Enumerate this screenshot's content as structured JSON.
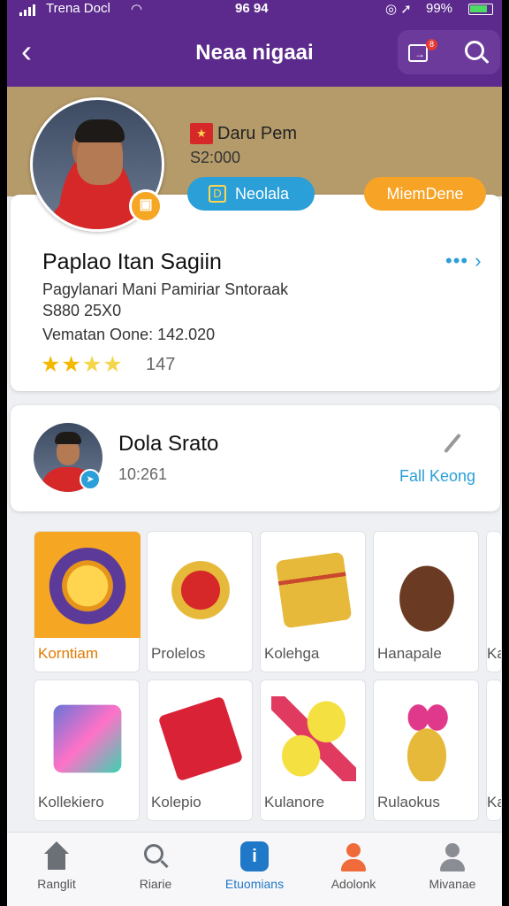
{
  "status_bar": {
    "carrier": "Trena Docl",
    "time": "96 94",
    "battery_percent": "99%"
  },
  "header": {
    "title": "Neaa nigaai",
    "notification_count": "8"
  },
  "profile": {
    "subtitle": "Daru Pem",
    "amount": "S2:000",
    "pill_blue_label": "Neolala",
    "pill_orange_label": "MiemDene",
    "name": "Paplao Itan Sagiin",
    "more_label": "•••",
    "description": "Pagylanari Mani Pamiriar Sntoraak",
    "id_line": "S880 25X0",
    "stat_line": "Vematan Oone: 142.020",
    "stars": 4,
    "rating": "147"
  },
  "player": {
    "name": "Dola Srato",
    "time": "10:261",
    "link_label": "Fall Keong"
  },
  "items": [
    {
      "label": "Korntiam",
      "icon": "badge-icon",
      "selected": true
    },
    {
      "label": "Prolelos",
      "icon": "token-icon",
      "selected": false
    },
    {
      "label": "Kolehga",
      "icon": "chest-icon",
      "selected": false
    },
    {
      "label": "Hanapale",
      "icon": "shoe-icon",
      "selected": false
    },
    {
      "label": "Ka",
      "icon": "partial-icon",
      "selected": false
    },
    {
      "label": "Kollekiero",
      "icon": "case-icon",
      "selected": false
    },
    {
      "label": "Kolepio",
      "icon": "wallet-icon",
      "selected": false
    },
    {
      "label": "Kulanore",
      "icon": "bottle-icon",
      "selected": false
    },
    {
      "label": "Rulaokus",
      "icon": "bow-icon",
      "selected": false
    },
    {
      "label": "Ka",
      "icon": "partial-icon",
      "selected": false
    }
  ],
  "nav": [
    {
      "label": "Ranglit",
      "icon": "home-icon",
      "active": false
    },
    {
      "label": "Riarie",
      "icon": "search-icon",
      "active": false
    },
    {
      "label": "Etuomians",
      "icon": "info-icon",
      "active": true
    },
    {
      "label": "Adolonk",
      "icon": "person-icon",
      "active": false
    },
    {
      "label": "Mivanae",
      "icon": "person-icon",
      "active": false
    }
  ],
  "colors": {
    "header_purple": "#5b2a8c",
    "banner_gold": "#b59b6a",
    "accent_blue": "#2a9fd8",
    "accent_orange": "#f7a325",
    "star_yellow": "#f5b800"
  }
}
